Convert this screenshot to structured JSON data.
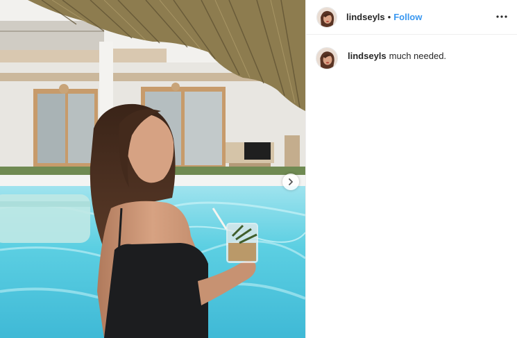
{
  "post": {
    "username": "lindseyls",
    "separator": "•",
    "follow_label": "Follow",
    "more_icon": "more-options-icon",
    "next_icon": "chevron-right-icon"
  },
  "comment": {
    "username": "lindseyls",
    "text": "much needed."
  },
  "colors": {
    "follow": "#3897f0",
    "text": "#262626",
    "divider": "#efefef",
    "pool": "#6fd3e4"
  }
}
